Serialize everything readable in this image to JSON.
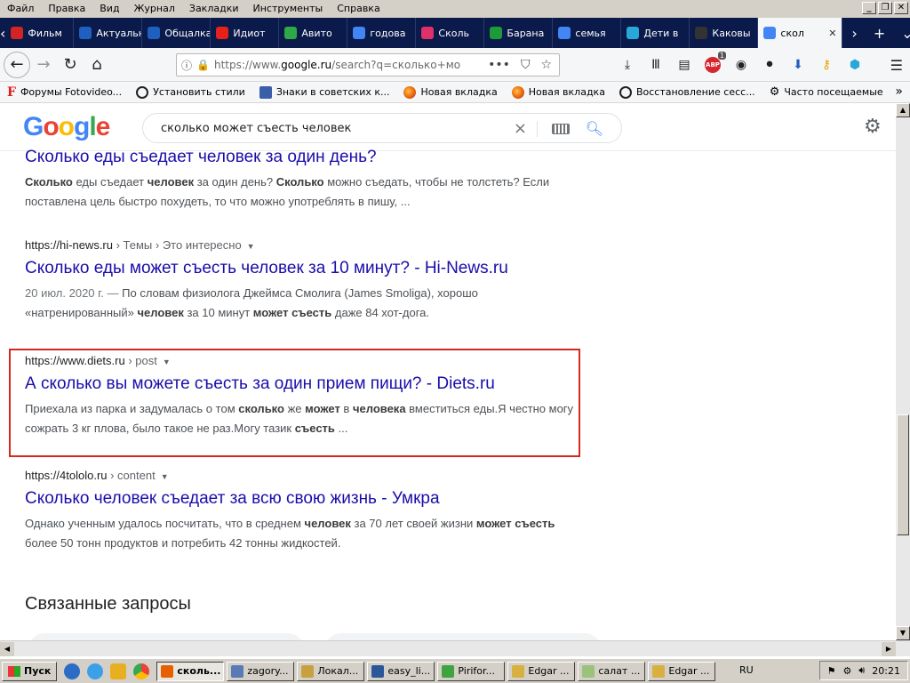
{
  "menubar": {
    "items": [
      "Файл",
      "Правка",
      "Вид",
      "Журнал",
      "Закладки",
      "Инструменты",
      "Справка"
    ]
  },
  "tabs": [
    {
      "label": "Фильм",
      "icon": "youtube-icon",
      "color": "#d32323"
    },
    {
      "label": "Актуальна",
      "icon": "page-icon",
      "color": "#1f5fbf"
    },
    {
      "label": "Общалка,",
      "icon": "page-icon",
      "color": "#1f5fbf"
    },
    {
      "label": "Идиот",
      "icon": "youtube-icon",
      "color": "#e62117"
    },
    {
      "label": "Авито",
      "icon": "avito-icon",
      "color": "#2fa847"
    },
    {
      "label": "годова",
      "icon": "google-icon",
      "color": "#4285f4"
    },
    {
      "label": "Сколь",
      "icon": "otvet-icon",
      "color": "#e0306a"
    },
    {
      "label": "Барана",
      "icon": "clover-icon",
      "color": "#1d9a3a"
    },
    {
      "label": "семья",
      "icon": "google-icon",
      "color": "#4285f4"
    },
    {
      "label": "Дети в",
      "icon": "flower-icon",
      "color": "#2aa7d9"
    },
    {
      "label": "Каковы",
      "icon": "hat-icon",
      "color": "#333333"
    },
    {
      "label": "скол",
      "icon": "google-icon",
      "color": "#4285f4",
      "active": true
    }
  ],
  "navbar": {
    "url_prefix": "https://www.",
    "url_host": "google.ru",
    "url_rest": "/search?q=сколько+мо",
    "abp_label": "ABP",
    "abp_badge": "1"
  },
  "bookmarks": [
    {
      "label": "Форумы Fotovideo...",
      "icon": "F"
    },
    {
      "label": "Установить стили",
      "icon": "globe-icon"
    },
    {
      "label": "Знаки в советских к...",
      "icon": "sign-icon"
    },
    {
      "label": "Новая вкладка",
      "icon": "firefox-icon"
    },
    {
      "label": "Новая вкладка",
      "icon": "firefox-icon"
    },
    {
      "label": "Восстановление сесс...",
      "icon": "globe-icon"
    },
    {
      "label": "Часто посещаемые",
      "icon": "gear-icon"
    }
  ],
  "google": {
    "logo_letters": [
      "G",
      "o",
      "o",
      "g",
      "l",
      "e"
    ],
    "logo_colors": [
      "#4285f4",
      "#ea4335",
      "#fbbc05",
      "#4285f4",
      "#34a853",
      "#ea4335"
    ],
    "query": "сколько может съесть человек"
  },
  "results": [
    {
      "title": "Сколько еды съедает человек за один день?",
      "snippet_parts": [
        {
          "t": "Сколько",
          "b": true
        },
        {
          "t": " еды съедает ",
          "b": false
        },
        {
          "t": "человек",
          "b": true
        },
        {
          "t": " за один день? ",
          "b": false
        },
        {
          "t": "Сколько",
          "b": true
        },
        {
          "t": " можно съедать, чтобы не толстеть? Если поставлена цель быстро похудеть, то что можно употреблять в пишу, ...",
          "b": false
        }
      ]
    },
    {
      "cite_url": "https://hi-news.ru",
      "cite_crumb": " › Темы › Это интересно",
      "title": "Сколько еды может съесть человек за 10 минут? - Hi-News.ru",
      "date": "20 июл. 2020 г. — ",
      "snippet_parts": [
        {
          "t": "По словам физиолога Джеймса Смолига (James Smoliga), хорошо «натренированный» ",
          "b": false
        },
        {
          "t": "человек",
          "b": true
        },
        {
          "t": " за 10 минут ",
          "b": false
        },
        {
          "t": "может съесть",
          "b": true
        },
        {
          "t": " даже 84 хот-дога.",
          "b": false
        }
      ]
    },
    {
      "cite_url": "https://www.diets.ru",
      "cite_crumb": " › post",
      "title": "А сколько вы можете съесть за один прием пищи? - Diets.ru",
      "snippet_parts": [
        {
          "t": "Приехала из парка и задумалась о том ",
          "b": false
        },
        {
          "t": "сколько",
          "b": true
        },
        {
          "t": " же ",
          "b": false
        },
        {
          "t": "может",
          "b": true
        },
        {
          "t": " в ",
          "b": false
        },
        {
          "t": "человека",
          "b": true
        },
        {
          "t": " вместиться еды.Я честно могу сожрать 3 кг плова, было такое не раз.Могу тазик ",
          "b": false
        },
        {
          "t": "съесть",
          "b": true
        },
        {
          "t": " ...",
          "b": false
        }
      ]
    },
    {
      "cite_url": "https://4tololo.ru",
      "cite_crumb": " › content",
      "title": "Сколько человек съедает за всю свою жизнь - Умкра",
      "snippet_parts": [
        {
          "t": "Однако ученным удалось посчитать, что в среднем ",
          "b": false
        },
        {
          "t": "человек",
          "b": true
        },
        {
          "t": " за 70 лет своей жизни ",
          "b": false
        },
        {
          "t": "может съесть",
          "b": true
        },
        {
          "t": " более 50 тонн продуктов и потребить 42 тонны жидкостей.",
          "b": false
        }
      ]
    }
  ],
  "related_heading": "Связанные запросы",
  "taskbar": {
    "start_label": "Пуск",
    "buttons": [
      {
        "label": "сколь...",
        "active": true,
        "color": "#e66000"
      },
      {
        "label": "zagory...",
        "active": false,
        "color": "#5a7ab5"
      },
      {
        "label": "Локал...",
        "active": false,
        "color": "#c8a040"
      },
      {
        "label": "easy_li...",
        "active": false,
        "color": "#2b579a"
      },
      {
        "label": "Pirifor...",
        "active": false,
        "color": "#3fa33f"
      },
      {
        "label": "Edgar ...",
        "active": false,
        "color": "#d8b040"
      },
      {
        "label": "салат ...",
        "active": false,
        "color": "#9bc27a"
      },
      {
        "label": "Edgar ...",
        "active": false,
        "color": "#d8b040"
      }
    ],
    "lang": "RU",
    "clock": "20:21"
  }
}
